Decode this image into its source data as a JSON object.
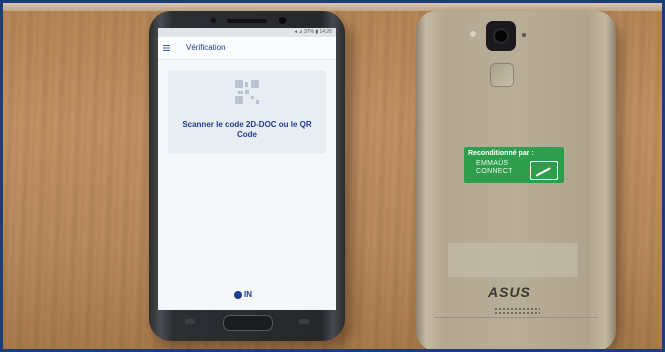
{
  "scene": {
    "description_objects": [
      "samsung-phone",
      "asus-phone",
      "wooden-table"
    ]
  },
  "left_phone": {
    "status_bar": "◂ ⊿ 37% ▮ 14:26",
    "app_title": "Vérification",
    "card_text": "Scanner le code 2D-DOC ou le QR Code",
    "logo_text": "IN"
  },
  "right_phone": {
    "sticker_title": "Reconditionné par :",
    "sticker_name": "EMMAÜS CONNECT",
    "brand_logo": "ASUS"
  },
  "colors": {
    "app_blue": "#1e3d8f",
    "sticker_green": "#2f9e4c",
    "border_blue": "#1c3d7a"
  }
}
